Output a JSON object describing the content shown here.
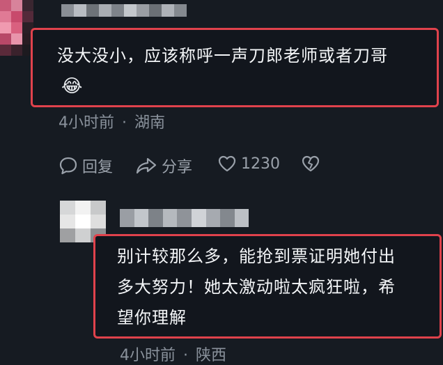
{
  "comments": [
    {
      "text": "没大没小，应该称呼一声刀郎老师或者刀哥",
      "emoji": "😂",
      "time": "4小时前",
      "separator": "·",
      "location": "湖南",
      "actions": {
        "reply_label": "回复",
        "share_label": "分享",
        "likes": "1230"
      }
    },
    {
      "text_line1": "别计较那么多，能抢到票证明她付出",
      "text_line2": "多大努力！她太激动啦太疯狂啦，希",
      "text_line3": "望你理解",
      "time": "4小时前",
      "separator": "·",
      "location": "陕西"
    }
  ],
  "colors": {
    "highlight_border": "#e0424c",
    "background": "#161b22",
    "muted_text": "#8a929c"
  }
}
